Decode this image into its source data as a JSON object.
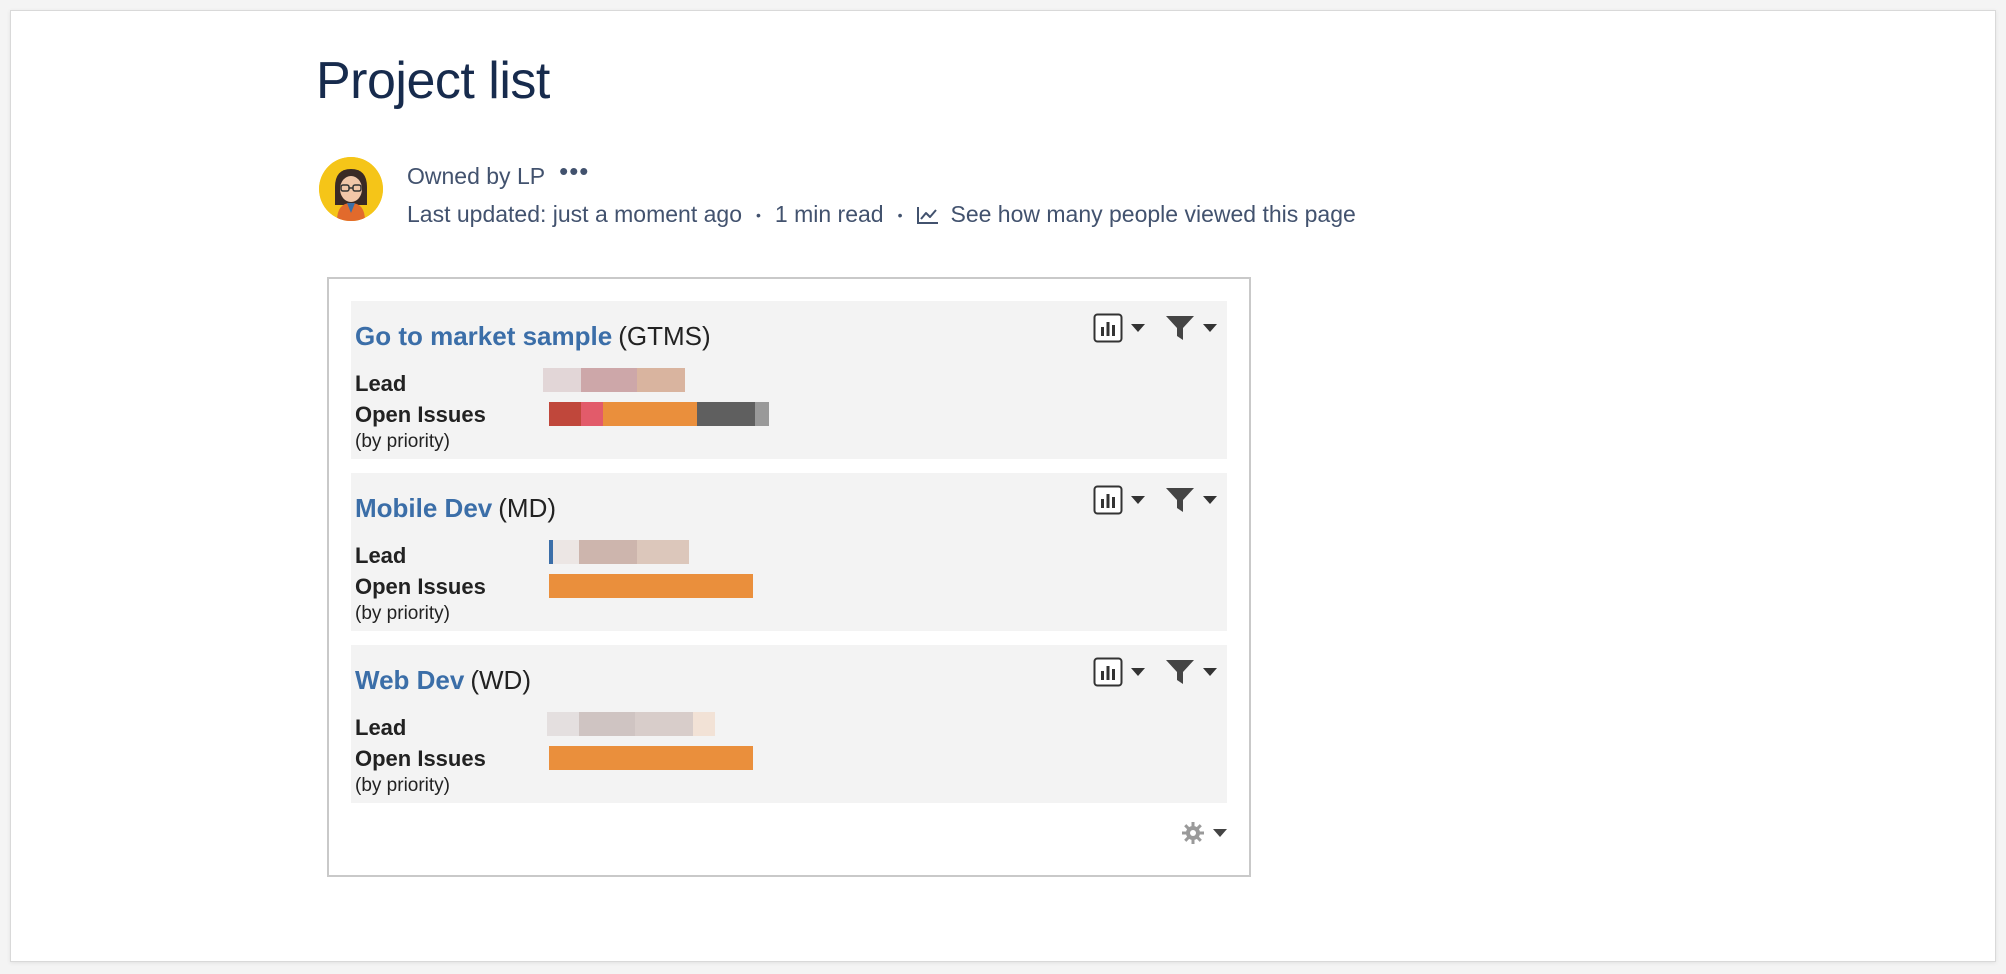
{
  "page": {
    "title": "Project list",
    "owned_by": "Owned by LP",
    "more": "•••",
    "last_updated": "Last updated: just a moment ago",
    "read_time": "1 min read",
    "views_link": "See how many people viewed this page",
    "separator": "•"
  },
  "labels": {
    "lead": "Lead",
    "open_issues": "Open Issues",
    "by_priority": "(by priority)"
  },
  "projects": [
    {
      "name": "Go to market sample",
      "key": "(GTMS)"
    },
    {
      "name": "Mobile Dev",
      "key": "(MD)"
    },
    {
      "name": "Web Dev",
      "key": "(WD)"
    }
  ],
  "icons": {
    "avatar": "user-avatar",
    "chart": "bar-chart-icon",
    "filter": "filter-icon",
    "gear": "gear-icon",
    "views": "analytics-icon"
  },
  "colors": {
    "title": "#172b4d",
    "meta": "#42526e",
    "project_link": "#3b6ea8",
    "priority_highest": "#c0473b",
    "priority_high": "#e25b6a",
    "priority_medium": "#ea8f3c",
    "priority_low": "#5f5f5f",
    "priority_lowest": "#999999"
  }
}
